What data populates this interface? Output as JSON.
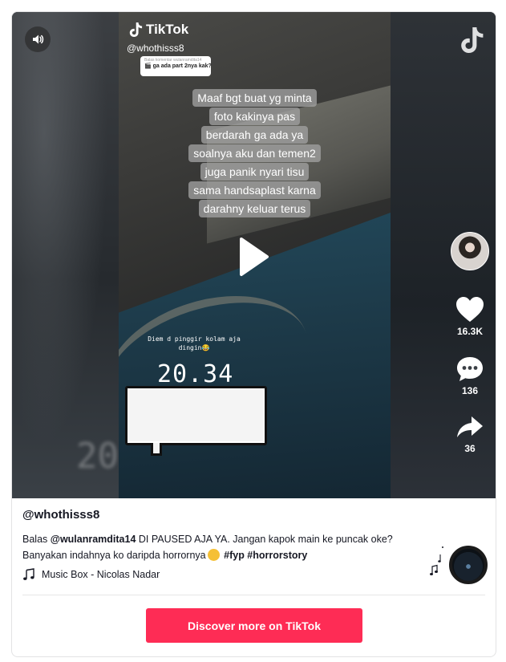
{
  "video": {
    "brand": "TikTok",
    "handle": "@whothisss8",
    "reply_sticker": {
      "header": "Balas komentar wulanramdita14",
      "text": "🎬 ga ada part 2nya kak?"
    },
    "caption_lines": [
      "Maaf bgt buat yg minta",
      "foto kakinya pas",
      "berdarah ga ada ya",
      "soalnya aku dan temen2",
      "juga panik nyari tisu",
      "sama handsaplast karna",
      "darahny keluar terus"
    ],
    "overlay_note_line1": "Diem d pinggir kolam aja",
    "overlay_note_line2": "dingin😂",
    "temperature": "20.34",
    "blur_number": "20"
  },
  "actions": {
    "likes": "16.3K",
    "comments": "136",
    "shares": "36"
  },
  "post": {
    "username": "@whothisss8",
    "desc_prefix": "Balas ",
    "mention": "@wulanramdita14",
    "desc_body": "  DI PAUSED AJA YA. Jangan kapok main ke puncak oke? Banyakan indahnya ko daripda horrornya",
    "tags": "#fyp #horrorstory",
    "music": "Music Box - Nicolas Nadar"
  },
  "cta": {
    "label": "Discover more on TikTok"
  },
  "icons": {
    "sound": "speaker-icon",
    "logo": "tiktok-logo-icon",
    "like": "heart-icon",
    "comment": "comment-icon",
    "share": "share-icon",
    "music": "music-note-icon",
    "play": "play-icon"
  },
  "colors": {
    "accent": "#fe2c55",
    "text": "#161823"
  }
}
